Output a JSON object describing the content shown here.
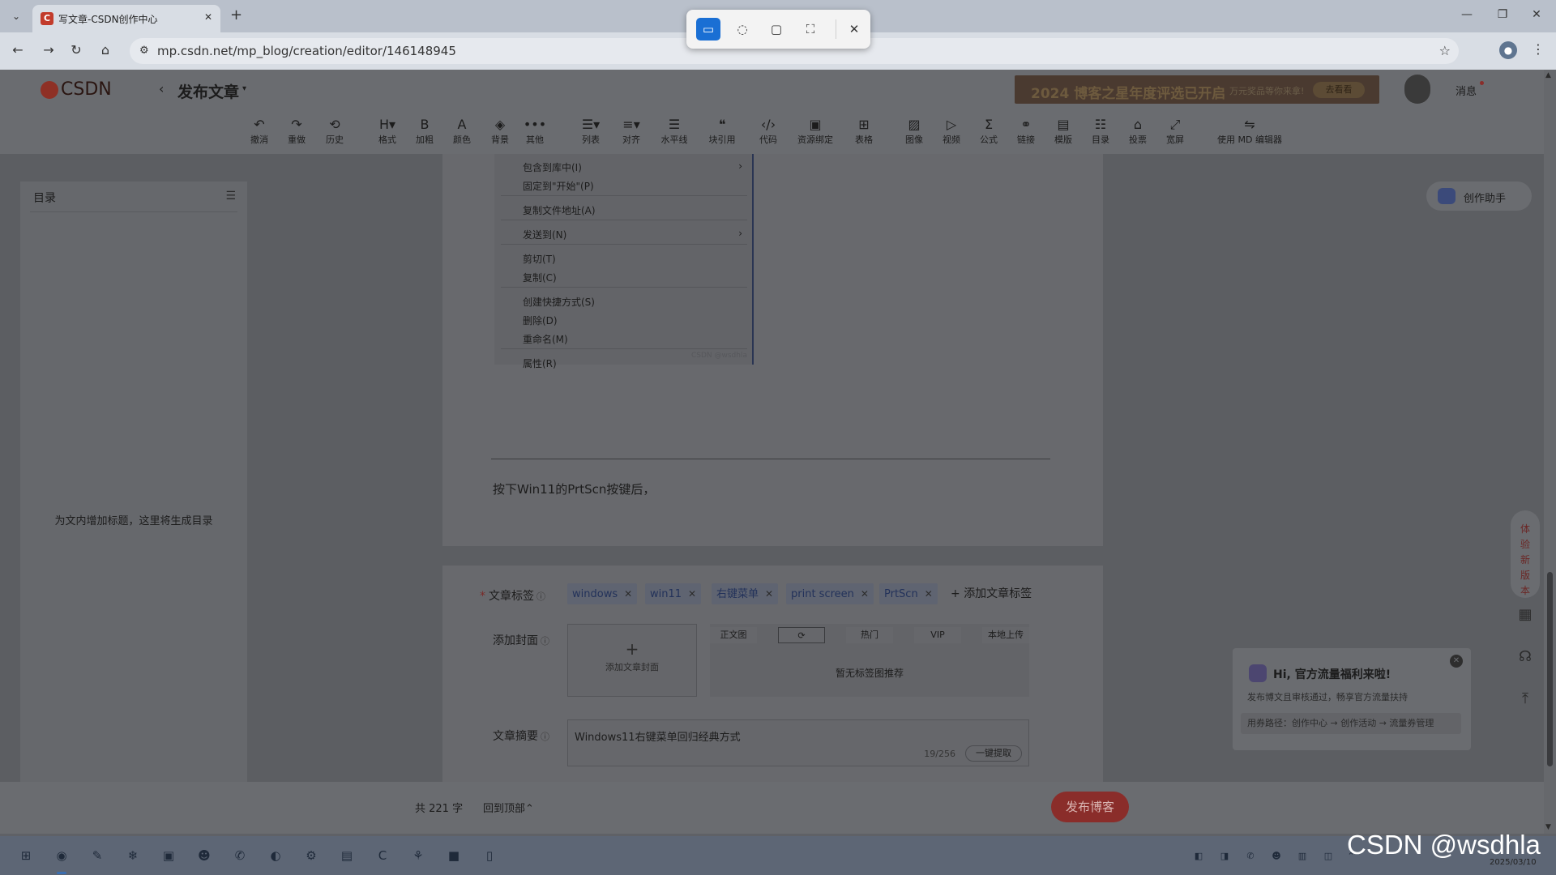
{
  "browser": {
    "tab_title": "写文章-CSDN创作中心",
    "tab_favicon": "C",
    "new_tab": "+",
    "url": "mp.csdn.net/mp_blog/creation/editor/146148945"
  },
  "header": {
    "logo_text": "CSDN",
    "back": "‹",
    "title": "发布文章",
    "title_caret": "▾",
    "banner_text": "2024 博客之星年度评选已开启",
    "banner_sub": "万元奖品等你来拿!",
    "banner_button": "去看看",
    "messages": "消息"
  },
  "toolbar": [
    {
      "icon": "↶",
      "label": "撤消",
      "icon_name": "undo-icon"
    },
    {
      "icon": "↷",
      "label": "重做",
      "icon_name": "redo-icon"
    },
    {
      "icon": "⟲",
      "label": "历史",
      "icon_name": "history-icon"
    },
    {
      "icon": "H▾",
      "label": "格式",
      "icon_name": "heading-icon"
    },
    {
      "icon": "B",
      "label": "加粗",
      "icon_name": "bold-icon"
    },
    {
      "icon": "A",
      "label": "颜色",
      "icon_name": "font-color-icon"
    },
    {
      "icon": "◈",
      "label": "背景",
      "icon_name": "background-color-icon"
    },
    {
      "icon": "•••",
      "label": "其他",
      "icon_name": "more-icon"
    },
    {
      "icon": "☰▾",
      "label": "列表",
      "icon_name": "list-icon"
    },
    {
      "icon": "≡▾",
      "label": "对齐",
      "icon_name": "align-icon"
    },
    {
      "icon": "☰",
      "label": "水平线",
      "icon_name": "horizontal-rule-icon"
    },
    {
      "icon": "❝",
      "label": "块引用",
      "icon_name": "blockquote-icon"
    },
    {
      "icon": "‹/›",
      "label": "代码",
      "icon_name": "code-icon"
    },
    {
      "icon": "▣",
      "label": "资源绑定",
      "icon_name": "resource-icon"
    },
    {
      "icon": "⊞",
      "label": "表格",
      "icon_name": "table-icon"
    },
    {
      "icon": "▨",
      "label": "图像",
      "icon_name": "image-icon"
    },
    {
      "icon": "▷",
      "label": "视频",
      "icon_name": "video-icon"
    },
    {
      "icon": "Σ",
      "label": "公式",
      "icon_name": "formula-icon"
    },
    {
      "icon": "⚭",
      "label": "链接",
      "icon_name": "link-icon"
    },
    {
      "icon": "▤",
      "label": "模版",
      "icon_name": "template-icon"
    },
    {
      "icon": "☷",
      "label": "目录",
      "icon_name": "toc-icon"
    },
    {
      "icon": "⌂",
      "label": "投票",
      "icon_name": "vote-icon"
    },
    {
      "icon": "⤢",
      "label": "宽屏",
      "icon_name": "widescreen-icon"
    },
    {
      "icon": "⇋",
      "label": "使用 MD 编辑器",
      "icon_name": "md-editor-icon"
    }
  ],
  "toc": {
    "title": "目录",
    "empty_hint": "为文内增加标题，这里将生成目录"
  },
  "context_menu": [
    {
      "label": "包含到库中(I)",
      "submenu": true
    },
    {
      "label": "固定到\"开始\"(P)",
      "submenu": false
    },
    {
      "label": "复制文件地址(A)",
      "submenu": false
    },
    {
      "label": "发送到(N)",
      "submenu": true
    },
    {
      "label": "剪切(T)",
      "submenu": false
    },
    {
      "label": "复制(C)",
      "submenu": false
    },
    {
      "label": "创建快捷方式(S)",
      "submenu": false
    },
    {
      "label": "删除(D)",
      "submenu": false
    },
    {
      "label": "重命名(M)",
      "submenu": false
    },
    {
      "label": "属性(R)",
      "submenu": false
    }
  ],
  "context_menu_watermark": "CSDN @wsdhla",
  "editor": {
    "paragraph": "按下Win11的PrtScn按键后，"
  },
  "meta": {
    "tags_label": "文章标签",
    "tags": [
      "windows",
      "win11",
      "右键菜单",
      "print screen",
      "PrtScn"
    ],
    "add_tag": "添加文章标签",
    "cover_label": "添加封面",
    "cover_upload": "添加文章封面",
    "cover_tabs": [
      "正文图",
      "⟳",
      "热门",
      "VIP",
      "本地上传"
    ],
    "cover_empty": "暂无标签图推荐",
    "summary_label": "文章摘要",
    "summary_value": "Windows11右键菜单回归经典方式",
    "summary_count": "19/256",
    "summary_button": "一键提取"
  },
  "assistant": {
    "label": "创作助手"
  },
  "side_rail": {
    "try_new": "体验新版本"
  },
  "promo": {
    "title": "Hi, 官方流量福利来啦!",
    "desc": "发布博文且审核通过，畅享官方流量扶持",
    "path": "用券路径：创作中心 → 创作活动 → 流量券管理"
  },
  "footer": {
    "word_count": "共 221 字",
    "back_top": "回到顶部⌃",
    "publish": "发布博客"
  },
  "taskbar": {
    "date": "2025/03/10"
  },
  "watermark": "CSDN @wsdhla",
  "colors": {
    "snip_active": "#1a6fd4",
    "csdn_red": "#c23b2b",
    "overlay_dim": "#5f6166"
  }
}
